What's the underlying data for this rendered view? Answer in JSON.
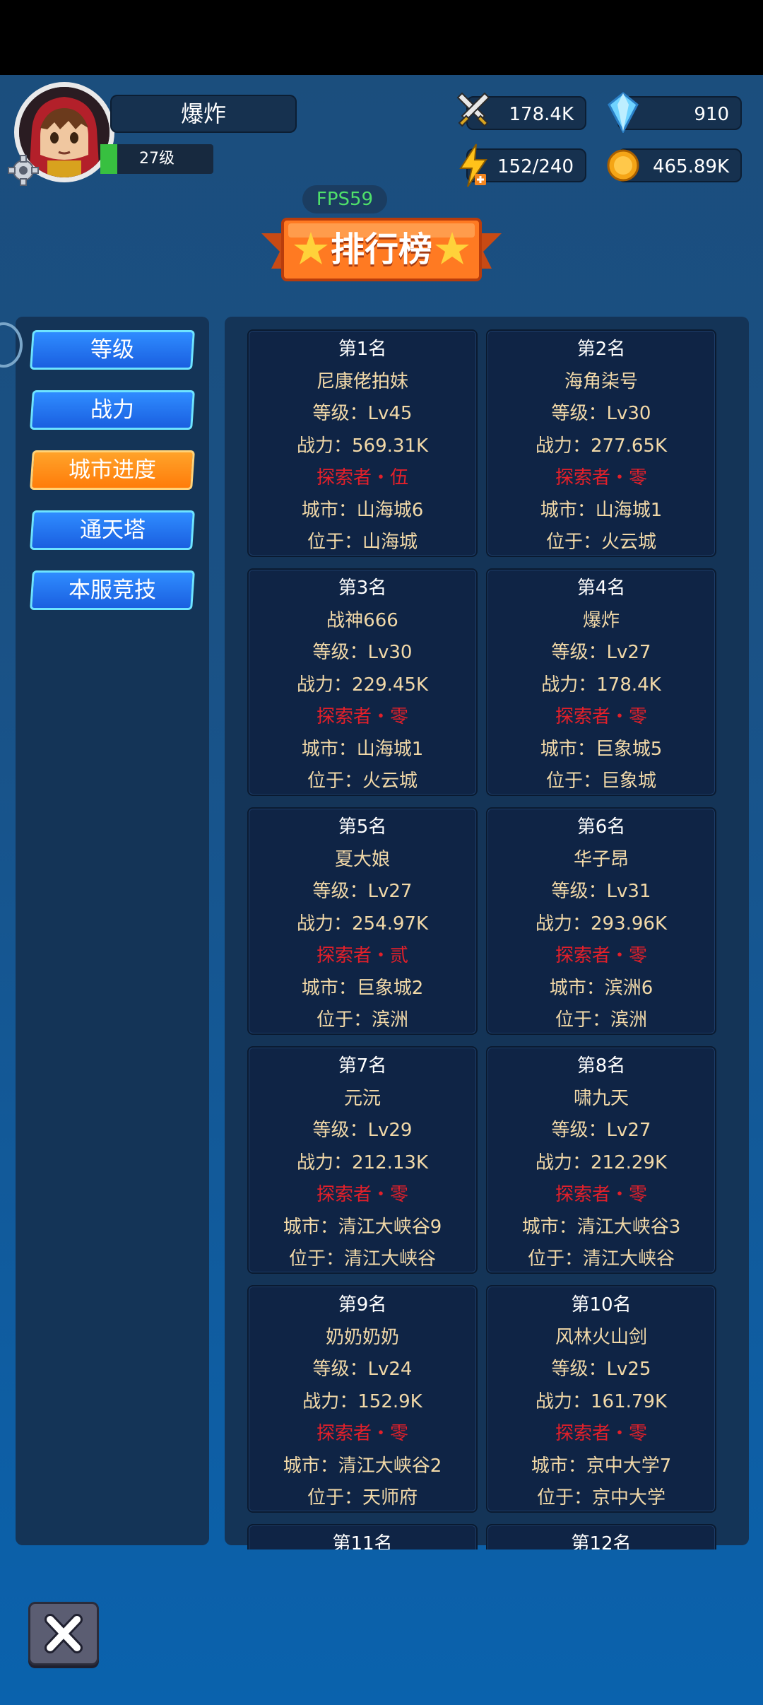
{
  "header": {
    "player_name": "爆炸",
    "level": "27级",
    "fps": "FPS59"
  },
  "resources": {
    "power": "178.4K",
    "gems": "910",
    "energy": "152/240",
    "gold": "465.89K"
  },
  "banner": {
    "title": "排行榜"
  },
  "tabs": [
    {
      "label": "等级",
      "active": false
    },
    {
      "label": "战力",
      "active": false
    },
    {
      "label": "城市进度",
      "active": true
    },
    {
      "label": "通天塔",
      "active": false
    },
    {
      "label": "本服竞技",
      "active": false
    }
  ],
  "rankings": [
    {
      "rank": "第1名",
      "name": "尼康佬拍妹",
      "level": "等级：Lv45",
      "power": "战力：569.31K",
      "title": "探索者・伍",
      "city": "城市：山海城6",
      "location": "位于：山海城"
    },
    {
      "rank": "第2名",
      "name": "海角柒号",
      "level": "等级：Lv30",
      "power": "战力：277.65K",
      "title": "探索者・零",
      "city": "城市：山海城1",
      "location": "位于：火云城"
    },
    {
      "rank": "第3名",
      "name": "战神666",
      "level": "等级：Lv30",
      "power": "战力：229.45K",
      "title": "探索者・零",
      "city": "城市：山海城1",
      "location": "位于：火云城"
    },
    {
      "rank": "第4名",
      "name": "爆炸",
      "level": "等级：Lv27",
      "power": "战力：178.4K",
      "title": "探索者・零",
      "city": "城市：巨象城5",
      "location": "位于：巨象城"
    },
    {
      "rank": "第5名",
      "name": "夏大娘",
      "level": "等级：Lv27",
      "power": "战力：254.97K",
      "title": "探索者・贰",
      "city": "城市：巨象城2",
      "location": "位于：滨洲"
    },
    {
      "rank": "第6名",
      "name": "华子昂",
      "level": "等级：Lv31",
      "power": "战力：293.96K",
      "title": "探索者・零",
      "city": "城市：滨洲6",
      "location": "位于：滨洲"
    },
    {
      "rank": "第7名",
      "name": "元沅",
      "level": "等级：Lv29",
      "power": "战力：212.13K",
      "title": "探索者・零",
      "city": "城市：清江大峡谷9",
      "location": "位于：清江大峡谷"
    },
    {
      "rank": "第8名",
      "name": "啸九天",
      "level": "等级：Lv27",
      "power": "战力：212.29K",
      "title": "探索者・零",
      "city": "城市：清江大峡谷3",
      "location": "位于：清江大峡谷"
    },
    {
      "rank": "第9名",
      "name": "奶奶奶奶",
      "level": "等级：Lv24",
      "power": "战力：152.9K",
      "title": "探索者・零",
      "city": "城市：清江大峡谷2",
      "location": "位于：天师府"
    },
    {
      "rank": "第10名",
      "name": "风林火山剑",
      "level": "等级：Lv25",
      "power": "战力：161.79K",
      "title": "探索者・零",
      "city": "城市：京中大学7",
      "location": "位于：京中大学"
    },
    {
      "rank": "第11名",
      "name": "",
      "level": "",
      "power": "",
      "title": "",
      "city": "",
      "location": ""
    },
    {
      "rank": "第12名",
      "name": "",
      "level": "",
      "power": "",
      "title": "",
      "city": "",
      "location": ""
    }
  ]
}
